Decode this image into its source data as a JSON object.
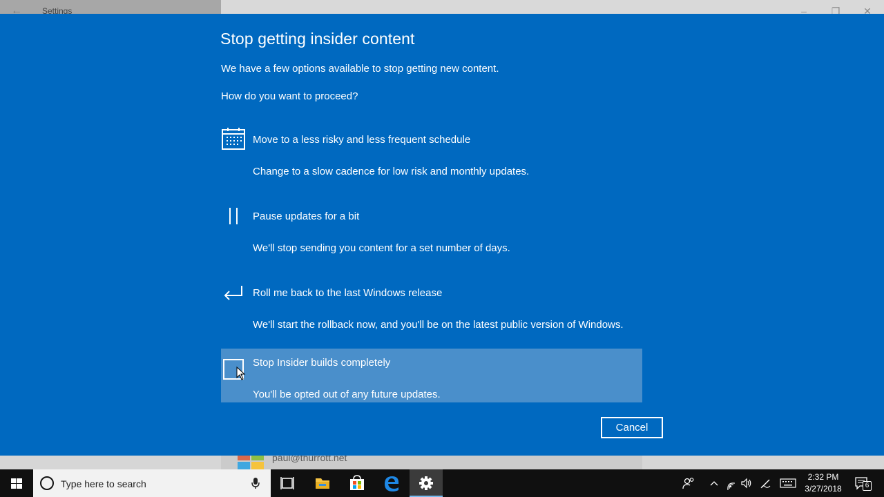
{
  "window": {
    "title": "Settings",
    "account_email": "paul@thurrott.net"
  },
  "dialog": {
    "title": "Stop getting insider content",
    "intro": "We have a few options available to stop getting new content.",
    "question": "How do you want to proceed?",
    "options": [
      {
        "icon": "calendar-icon",
        "title": "Move to a less risky and less frequent schedule",
        "description": "Change to a slow cadence for low risk and monthly updates.",
        "selected": false
      },
      {
        "icon": "pause-icon",
        "title": "Pause updates for a bit",
        "description": "We'll stop sending you content for a set number of days.",
        "selected": false
      },
      {
        "icon": "rollback-arrow-icon",
        "title": "Roll me back to the last Windows release",
        "description": "We'll start the rollback now, and you'll be on the latest public version of Windows.",
        "selected": false
      },
      {
        "icon": "stop-square-icon",
        "title": "Stop Insider builds completely",
        "description": "You'll be opted out of any future updates.",
        "selected": true
      }
    ],
    "cancel_label": "Cancel"
  },
  "taskbar": {
    "search_placeholder": "Type here to search",
    "apps": [
      "task-view-icon",
      "file-explorer-icon",
      "store-icon",
      "edge-icon",
      "settings-gear-icon"
    ],
    "active_app": "settings-gear-icon",
    "clock": {
      "time": "2:32 PM",
      "date": "3/27/2018"
    },
    "notification_count": "6"
  },
  "colors": {
    "dialog_bg": "#0069c0",
    "selected_bg": "#4a8fcb",
    "taskbar_bg": "#101010"
  }
}
